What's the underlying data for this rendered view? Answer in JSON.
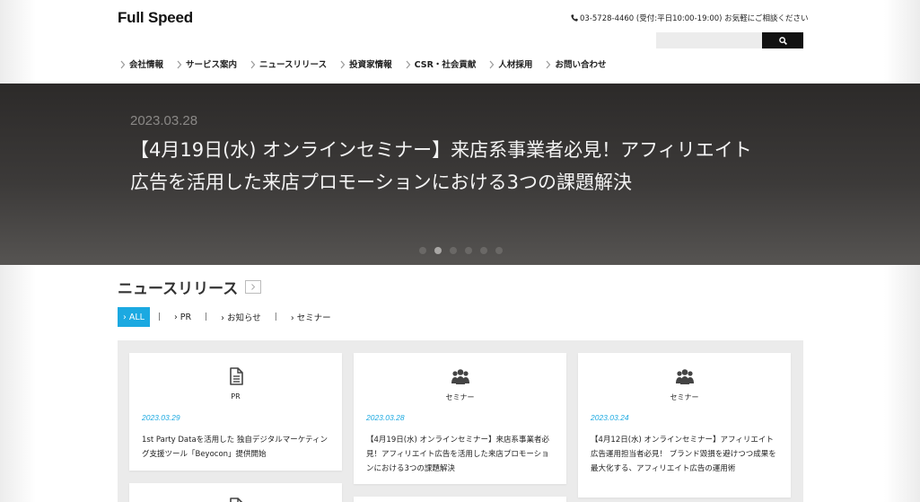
{
  "header": {
    "logo": "Full Speed",
    "contact": "03-5728-4460 (受付:平日10:00-19:00) お気軽にご相談ください",
    "search_placeholder": "",
    "nav": [
      "会社情報",
      "サービス案内",
      "ニュースリリース",
      "投資家情報",
      "CSR・社会貢献",
      "人材採用",
      "お問い合わせ"
    ]
  },
  "hero": {
    "date": "2023.03.28",
    "title_line1": "【4月19日(水) オンラインセミナー】来店系事業者必見！アフィリエイト",
    "title_line2": "広告を活用した来店プロモーションにおける3つの課題解決",
    "slide_count": 6,
    "active_slide": 2
  },
  "news": {
    "heading": "ニュースリリース",
    "filters": [
      "› ALL",
      "› PR",
      "› お知らせ",
      "› セミナー"
    ],
    "active_filter": "› ALL",
    "cards": [
      {
        "icon": "document-icon",
        "category": "PR",
        "date": "2023.03.29",
        "title": "1st Party Dataを活用した 独自デジタルマーケティング支援ツール「Beyocon」提供開始"
      },
      {
        "icon": "group-icon",
        "category": "セミナー",
        "date": "2023.03.28",
        "title": "【4月19日(水) オンラインセミナー】来店系事業者必見！アフィリエイト広告を活用した来店プロモーションにおける3つの課題解決"
      },
      {
        "icon": "group-icon",
        "category": "セミナー",
        "date": "2023.03.24",
        "title": "【4月12日(水) オンラインセミナー】アフィリエイト広告運用担当者必見！ ブランド毀損を避けつつ成果を最大化する、アフィリエイト広告の運用術"
      }
    ]
  },
  "colors": {
    "accent": "#1ba9e1",
    "hero_bg": "#33312f",
    "cards_bg": "#ebebeb"
  }
}
